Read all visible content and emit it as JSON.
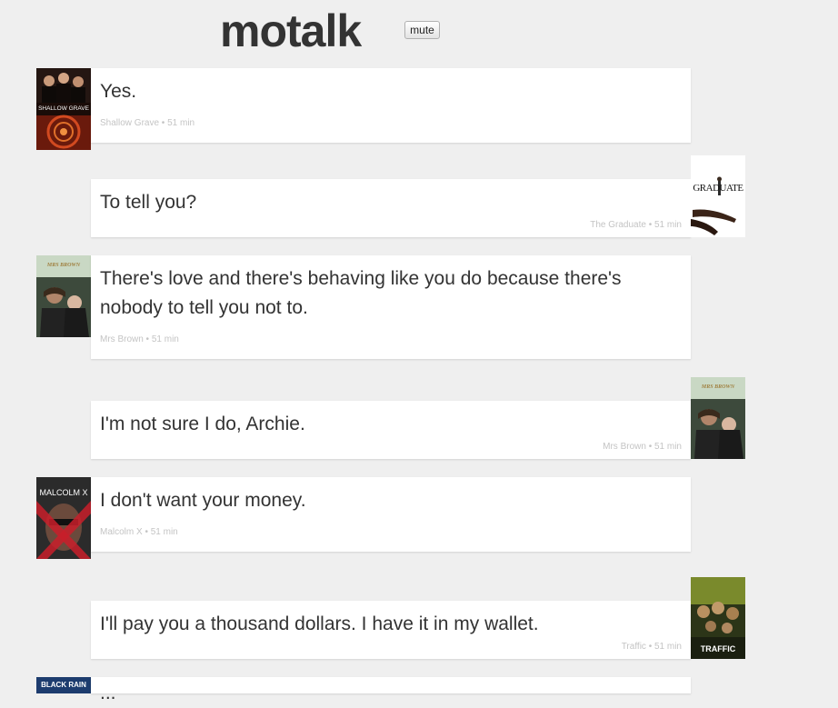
{
  "app": {
    "logo": "motalk",
    "mute_label": "mute"
  },
  "messages": [
    {
      "text": "Yes.",
      "movie": "Shallow Grave",
      "time": "51 min",
      "meta": "Shallow Grave • 51 min",
      "side": "left",
      "poster": {
        "icon": "shallow-grave-poster-icon",
        "title": "SHALLOW GRAVE",
        "bg": "#5a1a10",
        "text_color": "#ffffff"
      }
    },
    {
      "text": "To tell you?",
      "movie": "The Graduate",
      "time": "51 min",
      "meta": "The Graduate • 51 min",
      "side": "right",
      "poster": {
        "icon": "the-graduate-poster-icon",
        "title": "GRADUATE",
        "bg": "#ffffff",
        "text_color": "#111111"
      }
    },
    {
      "text": "There's love and there's behaving like you do because there's nobody to tell you not to.",
      "movie": "Mrs Brown",
      "time": "51 min",
      "meta": "Mrs Brown • 51 min",
      "side": "left",
      "poster": {
        "icon": "mrs-brown-poster-icon",
        "title": "MRS BROWN",
        "bg": "#6f8f7a",
        "text_color": "#f1e6b8"
      }
    },
    {
      "text": "I'm not sure I do, Archie.",
      "movie": "Mrs Brown",
      "time": "51 min",
      "meta": "Mrs Brown • 51 min",
      "side": "right",
      "poster": {
        "icon": "mrs-brown-poster-icon",
        "title": "MRS BROWN",
        "bg": "#6f8f7a",
        "text_color": "#f1e6b8"
      }
    },
    {
      "text": "I don't want your money.",
      "movie": "Malcolm X",
      "time": "51 min",
      "meta": "Malcolm X • 51 min",
      "side": "left",
      "poster": {
        "icon": "malcolm-x-poster-icon",
        "title": "MALCOLM X",
        "bg": "#2a2a2a",
        "text_color": "#ffffff"
      }
    },
    {
      "text": "I'll pay you a thousand dollars. I have it in my wallet.",
      "movie": "Traffic",
      "time": "51 min",
      "meta": "Traffic • 51 min",
      "side": "right",
      "poster": {
        "icon": "traffic-poster-icon",
        "title": "TRAFFIC",
        "bg": "#2f3a1c",
        "text_color": "#ffffff"
      }
    },
    {
      "text": "...",
      "movie": "Black Rain",
      "side": "left",
      "poster": {
        "icon": "black-rain-poster-icon",
        "title": "BLACK RAIN",
        "bg": "#1d3c6e",
        "text_color": "#ffffff"
      }
    }
  ]
}
